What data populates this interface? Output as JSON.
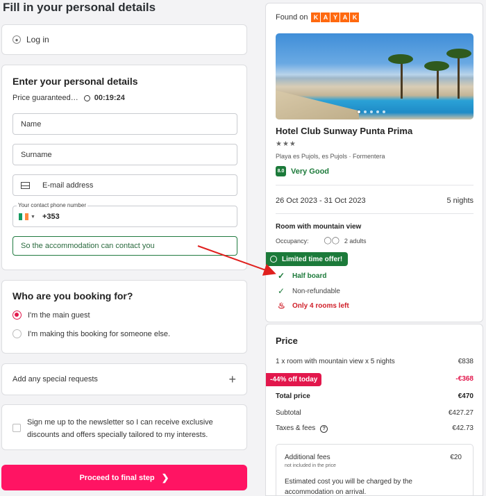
{
  "page_title": "Fill in your personal details",
  "login": {
    "label": "Log in"
  },
  "personal": {
    "title": "Enter your personal details",
    "price_guaranteed": "Price guaranteed…",
    "timer": "00:19:24",
    "name_placeholder": "Name",
    "surname_placeholder": "Surname",
    "email_placeholder": "E-mail address",
    "phone_legend": "Your contact phone number",
    "phone_code": "+353",
    "contact_note": "So the accommodation can contact you"
  },
  "booking_for": {
    "title": "Who are you booking for?",
    "options": [
      "I'm the main guest",
      "I'm making this booking for someone else."
    ],
    "selected": 0
  },
  "special_requests": {
    "label": "Add any special requests",
    "icon": "plus-icon"
  },
  "newsletter": {
    "text": "Sign me up to the newsletter so I can receive exclusive discounts and offers specially tailored to my interests."
  },
  "proceed": {
    "label": "Proceed to final step"
  },
  "hotel": {
    "found_on": "Found on",
    "kayak_letters": [
      "K",
      "A",
      "Y",
      "A",
      "K"
    ],
    "name": "Hotel Club Sunway Punta Prima",
    "stars": "★★★",
    "location": "Playa es Pujols, es Pujols · Formentera",
    "score": "8.0",
    "score_label": "Very Good",
    "dates": "26 Oct 2023 - 31 Oct 2023",
    "nights": "5 nights",
    "room": "Room with mountain view",
    "occupancy_label": "Occupancy:",
    "occupancy": "2 adults",
    "limited": "Limited time offer!",
    "perks": [
      "Half board",
      "Non-refundable",
      "Only 4 rooms left"
    ]
  },
  "price": {
    "title": "Price",
    "room_line": "1 x room with mountain view x 5 nights",
    "room_amount": "€838",
    "discount_label": "-44% off today",
    "discount_amount": "-€368",
    "total_label": "Total price",
    "total_amount": "€470",
    "subtotal_label": "Subtotal",
    "subtotal_amount": "€427.27",
    "taxes_label": "Taxes & fees",
    "taxes_amount": "€42.73",
    "additional_label": "Additional fees",
    "additional_amount": "€20",
    "additional_sub": "not included in the price",
    "estimated": "Estimated cost you will be charged by the accommodation on arrival."
  },
  "colors": {
    "brand": "#ff1463",
    "green": "#1c7a3a",
    "discount": "#e2174c",
    "kayak": "#ff690f",
    "annotation": "#e0201e"
  }
}
